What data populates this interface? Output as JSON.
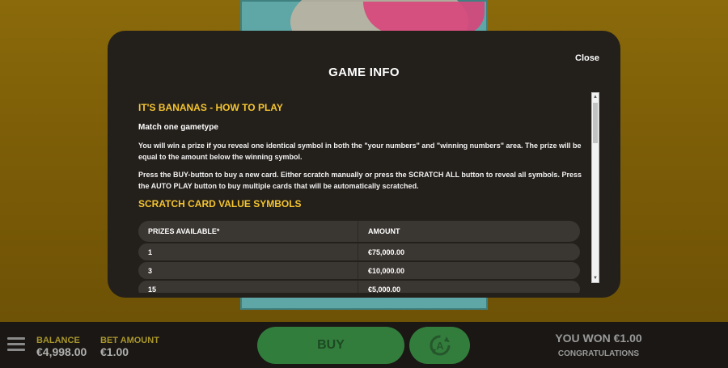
{
  "modal": {
    "title": "GAME INFO",
    "close_label": "Close",
    "heading": "IT'S BANANAS - HOW TO PLAY",
    "subheading": "Match one gametype",
    "paragraph1": "You will win a prize if you reveal one identical symbol in both the \"your numbers\" and \"winning numbers\" area. The prize will be equal to the amount below the winning symbol.",
    "paragraph2": "Press the BUY-button to buy a new card. Either scratch manually or press the SCRATCH ALL button to reveal all symbols. Press the AUTO PLAY button to buy multiple cards that will be automatically scratched.",
    "section_heading": "SCRATCH CARD VALUE SYMBOLS",
    "table": {
      "headers": [
        "PRIZES AVAILABLE*",
        "AMOUNT"
      ],
      "rows": [
        [
          "1",
          "€75,000.00"
        ],
        [
          "3",
          "€10,000.00"
        ],
        [
          "15",
          "€5,000.00"
        ]
      ]
    }
  },
  "bottom": {
    "balance_label": "BALANCE",
    "balance_value": "€4,998.00",
    "bet_label": "BET AMOUNT",
    "bet_value": "€1.00",
    "buy_label": "BUY",
    "won_text": "YOU WON €1.00",
    "congrats_text": "CONGRATULATIONS"
  },
  "colors": {
    "accent_yellow": "#f4c430",
    "buy_green": "#3aa04a",
    "modal_bg": "#231f1b"
  },
  "icons": [
    "menu-icon",
    "autoplay-icon",
    "scroll-up-icon",
    "scroll-down-icon"
  ]
}
